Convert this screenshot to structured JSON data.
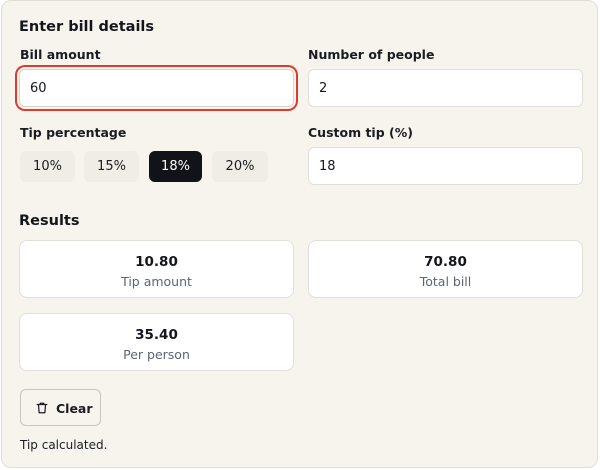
{
  "form": {
    "title": "Enter bill details",
    "bill_amount": {
      "label": "Bill amount",
      "value": "60"
    },
    "people": {
      "label": "Number of people",
      "value": "2"
    },
    "tip_percentage": {
      "label": "Tip percentage",
      "options": [
        "10%",
        "15%",
        "18%",
        "20%"
      ],
      "selected": "18%"
    },
    "custom_tip": {
      "label": "Custom tip (%)",
      "value": "18"
    }
  },
  "results": {
    "title": "Results",
    "tip_amount": {
      "value": "10.80",
      "label": "Tip amount"
    },
    "total_bill": {
      "value": "70.80",
      "label": "Total bill"
    },
    "per_person": {
      "value": "35.40",
      "label": "Per person"
    }
  },
  "actions": {
    "clear_label": "Clear",
    "clear_icon": "trash-icon"
  },
  "status": "Tip calculated.",
  "colors": {
    "panel_bg": "#f7f4ee",
    "focus_ring": "#dd3b2b",
    "active_button": "#111318",
    "muted_text": "#5b6478"
  }
}
